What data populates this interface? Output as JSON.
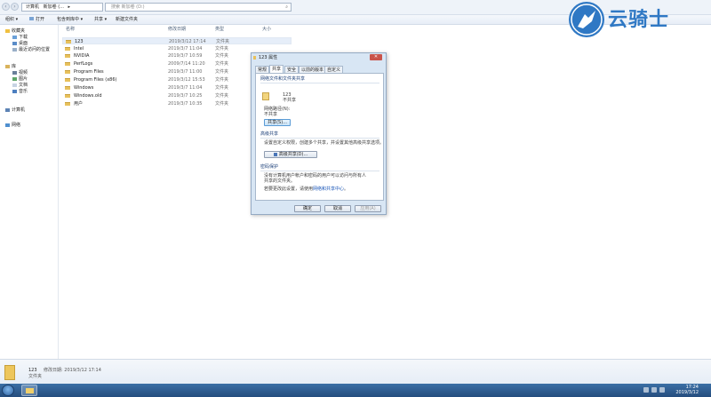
{
  "address": {
    "crumbs": [
      "计算机",
      "新加卷 (...",
      "▸"
    ],
    "search_placeholder": "搜索 新加卷 (D:)"
  },
  "toolbar": {
    "organize": "组织 ▾",
    "open": "打开",
    "include_in_library": "包含到库中 ▾",
    "share": "共享 ▾",
    "new_folder": "新建文件夹"
  },
  "sidebar": {
    "favorites": "收藏夹",
    "downloads": "下载",
    "desktop": "桌面",
    "recent": "最近访问的位置",
    "libraries": "库",
    "videos": "视频",
    "pictures": "图片",
    "documents": "文档",
    "music": "音乐",
    "computer": "计算机",
    "network": "网络"
  },
  "columns": {
    "name": "名称",
    "date": "修改日期",
    "type": "类型",
    "size": "大小"
  },
  "files": [
    {
      "name": "123",
      "date": "2019/3/12 17:14",
      "type": "文件夹"
    },
    {
      "name": "Intel",
      "date": "2019/3/7 11:04",
      "type": "文件夹"
    },
    {
      "name": "NVIDIA",
      "date": "2019/3/7 10:59",
      "type": "文件夹"
    },
    {
      "name": "PerfLogs",
      "date": "2009/7/14 11:20",
      "type": "文件夹"
    },
    {
      "name": "Program Files",
      "date": "2019/3/7 11:00",
      "type": "文件夹"
    },
    {
      "name": "Program Files (x86)",
      "date": "2019/3/12 15:53",
      "type": "文件夹"
    },
    {
      "name": "Windows",
      "date": "2019/3/7 11:04",
      "type": "文件夹"
    },
    {
      "name": "Windows.old",
      "date": "2019/3/7 10:25",
      "type": "文件夹"
    },
    {
      "name": "用户",
      "date": "2019/3/7 10:35",
      "type": "文件夹"
    }
  ],
  "dialog": {
    "title": "123 属性",
    "close": "✕",
    "tabs": [
      "常规",
      "共享",
      "安全",
      "以前的版本",
      "自定义"
    ],
    "section_network": "网络文件和文件夹共享",
    "folder_name": "123",
    "folder_state": "不共享",
    "path_label": "网络路径(N):",
    "path_value": "不共享",
    "share_button": "共享(S)...",
    "section_advanced": "高级共享",
    "advanced_desc": "设置自定义权限，创建多个共享，并设置其他高级共享选项。",
    "advanced_button": "高级共享(D)...",
    "section_password": "密码保护",
    "password_desc_1": "没有计算机用户帐户和密码的用户可以访问与所有人",
    "password_desc_2": "共享的文件夹。",
    "password_desc_3": "若要更改此设置，请使用",
    "password_link": "网络和共享中心",
    "password_desc_4": "。",
    "ok": "确定",
    "cancel": "取消",
    "apply": "应用(A)"
  },
  "details": {
    "name": "123",
    "modified_label": "修改日期: 2019/3/12 17:14",
    "type": "文件夹"
  },
  "taskbar": {
    "time": "17:24",
    "date": "2019/3/12"
  },
  "watermark": {
    "text": "云骑士"
  }
}
